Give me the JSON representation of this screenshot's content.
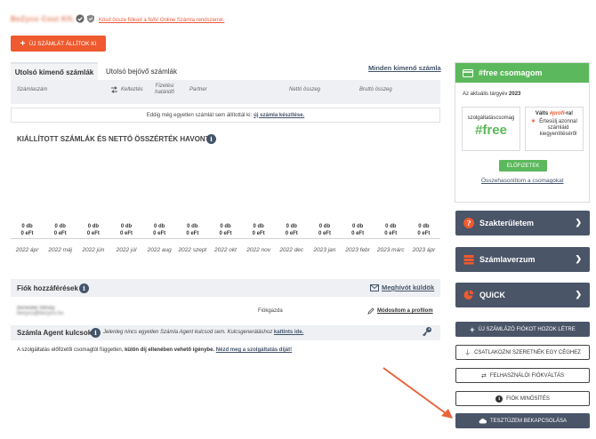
{
  "header": {
    "company_name": "BeZyco Coul Kft.",
    "nav_link": "Kösd össze fiókod a NAV Online Számla rendszerrel.",
    "new_invoice_label": "ÚJ SZÁMLÁT ÁLLÍTOK KI"
  },
  "tabs": [
    {
      "label": "Utolsó kimenő számlák"
    },
    {
      "label": "Utolsó bejövő számlák"
    }
  ],
  "all_outgoing_link": "Minden kimenő számla",
  "table": {
    "columns": [
      "Számlaszám",
      "Kelteztés",
      "Fizetési határidő",
      "Partner",
      "Nettó összeg",
      "Bruttó összeg"
    ],
    "empty_text": "Eddig még egyetlen számlát sem állítottál ki:",
    "empty_link": "új számla készítése."
  },
  "chart_data": {
    "type": "bar",
    "title": "KIÁLLÍTOTT SZÁMLÁK ÉS NETTÓ ÖSSZÉRTÉK HAVONTA",
    "categories": [
      "2022 ápr",
      "2022 máj",
      "2022 jún",
      "2022 júl",
      "2022 aug",
      "2022 szept",
      "2022 okt",
      "2022 nov",
      "2022 dec",
      "2023 jan",
      "2023 febr",
      "2023 márc",
      "2023 ápr"
    ],
    "series": [
      {
        "values": [
          0,
          0,
          0,
          0,
          0,
          0,
          0,
          0,
          0,
          0,
          0,
          0,
          0
        ]
      },
      {
        "values": [
          0,
          0,
          0,
          0,
          0,
          0,
          0,
          0,
          0,
          0,
          0,
          0,
          0
        ]
      }
    ],
    "count_labels": [
      "0 db",
      "0 db",
      "0 db",
      "0 db",
      "0 db",
      "0 db",
      "0 db",
      "0 db",
      "0 db",
      "0 db",
      "0 db",
      "0 db",
      "0 db"
    ],
    "amount_labels": [
      "0 eFt",
      "0 eFt",
      "0 eFt",
      "0 eFt",
      "0 eFt",
      "0 eFt",
      "0 eFt",
      "0 eFt",
      "0 eFt",
      "0 eFt",
      "0 eFt",
      "0 eFt",
      "0 eFt"
    ],
    "xlabel": "",
    "ylabel": "",
    "grid": false
  },
  "access": {
    "title": "Fiók hozzáférések",
    "invite": "Meghívót küldök",
    "user_name": "Benedek Mihály",
    "user_email": "bezyco@bezyco.hu",
    "role": "Fiókgazda",
    "modify": "Módosítom a profilom"
  },
  "agent": {
    "title": "Számla Agent kulcsok",
    "text": "Jelenleg nincs egyetlen Számla Agent kulcsod sem. Kulcsgeneráláshoz",
    "link": "kattints ide."
  },
  "note": {
    "text1": "A szolgáltatás előfizetői csomagtól független,",
    "bold": "külön díj ellenében vehető igénybe.",
    "link": "Nézd meg a szolgáltatás díját!"
  },
  "package": {
    "title": "#free csomagom",
    "year_label": "Az aktuális tárgyév",
    "year": "2023",
    "current_label": "szolgáltatáscsomag",
    "current_name": "#free",
    "switch_prefix": "Válts",
    "switch_name": "#profi",
    "switch_suffix": "-ra!",
    "switch_benefit": "Értesülj azonnal számláid kiegyenlítéséről",
    "subscribe": "ELŐFIZETEK",
    "compare": "Összehasonlítom a csomagokat"
  },
  "side_buttons": {
    "expertise": "Szakterületem",
    "universe": "Számlaverzum",
    "quick": "QUiCK",
    "new_account": "ÚJ SZÁMLÁZÓ FIÓKOT HOZOK LÉTRE",
    "connect": "CSATLAKOZNI SZERETNÉK EGY CÉGHEZ",
    "switch_user": "FELHASZNÁLÓI FIÓKVÁLTÁS",
    "rating": "FIÓK MINŐSÍTÉS",
    "test": "TESZTÜZEM BEKAPCSOLÁSA"
  },
  "colors": {
    "accent": "#ef5a2f",
    "green": "#5cb85c",
    "slate": "#4a5568"
  }
}
